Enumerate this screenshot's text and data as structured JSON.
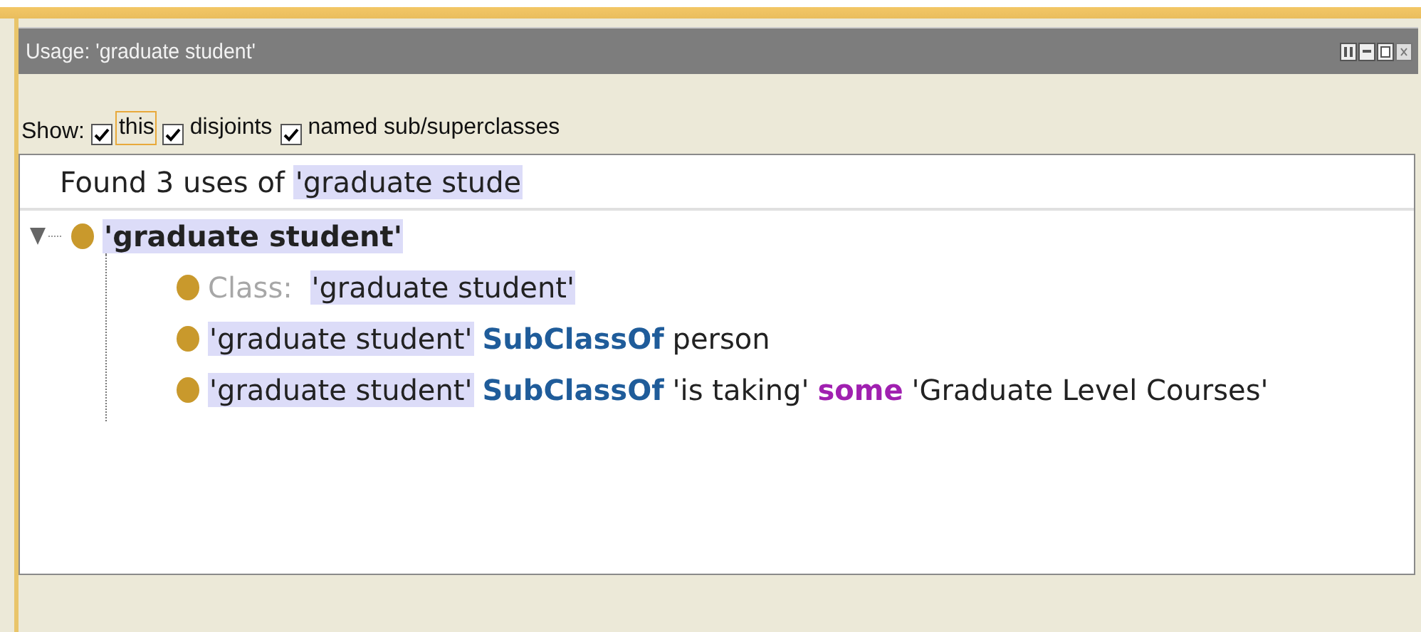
{
  "window": {
    "title": "Usage: 'graduate student'"
  },
  "show": {
    "label": "Show:",
    "options": [
      {
        "label": "this",
        "checked": true,
        "focused": true
      },
      {
        "label": "disjoints",
        "checked": true,
        "focused": false
      },
      {
        "label": "named sub/superclasses",
        "checked": true,
        "focused": false
      }
    ]
  },
  "summary": [
    {
      "kind": "plain",
      "text": "Found 3 uses of "
    },
    {
      "kind": "entity",
      "text": "'graduate stude"
    }
  ],
  "tree": [
    {
      "expanded": true,
      "tokens": [
        {
          "kind": "entity",
          "text": "'graduate student'"
        }
      ],
      "children": [
        {
          "tokens": [
            {
              "kind": "label",
              "text": "Class: "
            },
            {
              "kind": "entity",
              "text": "'graduate student'"
            }
          ]
        },
        {
          "tokens": [
            {
              "kind": "entity",
              "text": "'graduate student'"
            },
            {
              "kind": "keyword",
              "text": "SubClassOf"
            },
            {
              "kind": "plain",
              "text": "person"
            }
          ]
        },
        {
          "tokens": [
            {
              "kind": "entity",
              "text": "'graduate student'"
            },
            {
              "kind": "keyword",
              "text": "SubClassOf"
            },
            {
              "kind": "plain",
              "text": "'is taking'"
            },
            {
              "kind": "restriction",
              "text": "some"
            },
            {
              "kind": "plain",
              "text": "'Graduate Level Courses'"
            }
          ]
        }
      ]
    }
  ]
}
